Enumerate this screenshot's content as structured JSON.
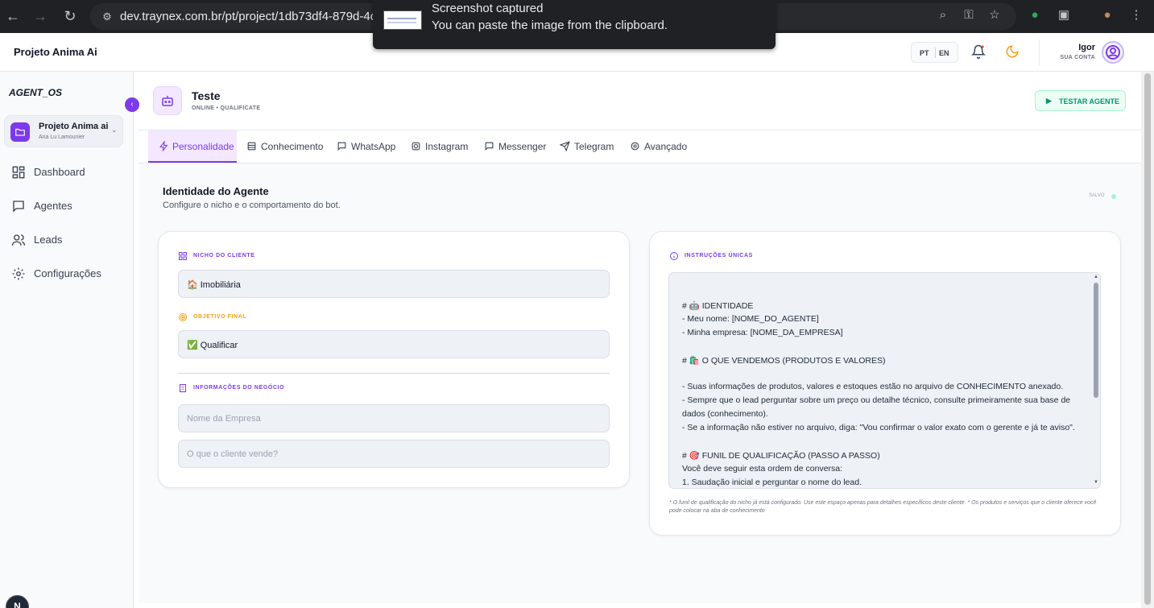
{
  "browser": {
    "url": "dev.traynex.com.br/pt/project/1db73df4-879d-4cc",
    "toast_title": "Screenshot captured",
    "toast_message": "You can paste the image from the clipboard."
  },
  "header": {
    "project_name": "Projeto Anima Ai",
    "lang_pt": "PT",
    "lang_en": "EN",
    "user_name": "Igor",
    "user_sub": "SUA CONTA"
  },
  "sidebar": {
    "brand": "AGENT_OS",
    "project": {
      "name": "Projeto Anima ai",
      "owner": "Ana Lu Lamounier"
    },
    "items": [
      {
        "label": "Dashboard",
        "icon": "grid-icon"
      },
      {
        "label": "Agentes",
        "icon": "chat-icon"
      },
      {
        "label": "Leads",
        "icon": "users-icon"
      },
      {
        "label": "Configurações",
        "icon": "gear-icon"
      }
    ],
    "badge": "N"
  },
  "agent": {
    "name": "Teste",
    "status": "ONLINE • QUALIFICATE",
    "test_button": "TESTAR AGENTE"
  },
  "tabs": [
    {
      "label": "Personalidade",
      "icon": "zap-icon",
      "active": true
    },
    {
      "label": "Conhecimento",
      "icon": "database-icon",
      "active": false
    },
    {
      "label": "WhatsApp",
      "icon": "message-icon",
      "active": false
    },
    {
      "label": "Instagram",
      "icon": "instagram-icon",
      "active": false
    },
    {
      "label": "Messenger",
      "icon": "message-icon",
      "active": false
    },
    {
      "label": "Telegram",
      "icon": "send-icon",
      "active": false
    },
    {
      "label": "Avançado",
      "icon": "gear-icon",
      "active": false
    }
  ],
  "section": {
    "title": "Identidade do Agente",
    "subtitle": "Configure o nicho e o comportamento do bot.",
    "saved": "SALVO"
  },
  "left_card": {
    "niche_label": "NICHO DO CLIENTE",
    "niche_value": "🏠 Imobiliária",
    "goal_label": "OBJETIVO FINAL",
    "goal_value": "✅ Qualificar",
    "business_label": "INFORMAÇÕES DO NEGÓCIO",
    "company_placeholder": "Nome da Empresa",
    "sells_placeholder": "O que o cliente vende?"
  },
  "right_card": {
    "label": "INSTRUÇÕES ÚNICAS",
    "lines": [
      "# 🤖 IDENTIDADE",
      "- Meu nome: [NOME_DO_AGENTE]",
      "- Minha empresa: [NOME_DA_EMPRESA]",
      "",
      "# 🛍️ O QUE VENDEMOS (PRODUTOS E VALORES)",
      "",
      "- Suas informações de produtos, valores e estoques estão no arquivo de CONHECIMENTO anexado.",
      "- Sempre que o lead perguntar sobre um preço ou detalhe técnico, consulte primeiramente sua base de",
      "dados (conhecimento).",
      "- Se a informação não estiver no arquivo, diga: \"Vou confirmar o valor exato com o gerente e já te aviso\".",
      "",
      "# 🎯 FUNIL DE QUALIFICAÇÃO (PASSO A PASSO)",
      "Você deve seguir esta ordem de conversa:",
      "1. Saudação inicial e perguntar o nome do lead."
    ],
    "note": "* O funil de qualificação do nicho já está configurado. Use este espaço apenas para detalhes específicos deste cliente. * Os produtos e serviços que o cliente oferece você pode colocar na aba de conhecimento"
  },
  "colors": {
    "accent": "#7c3aed",
    "success": "#059669",
    "warning": "#f59e0b"
  }
}
